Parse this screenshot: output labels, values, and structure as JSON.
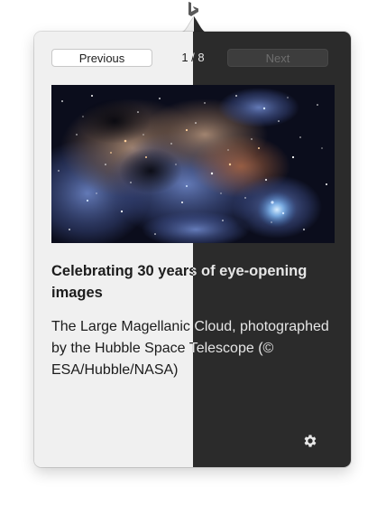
{
  "app": {
    "status_icon": "bing-logo-icon"
  },
  "navigation": {
    "previous_label": "Previous",
    "next_label": "Next",
    "counter": "1 / 8",
    "next_enabled": false
  },
  "slide": {
    "image_subject": "nebula-photo",
    "title": "Celebrating 30 years of eye-opening images",
    "description": "The Large Magellanic Cloud, photographed by the Hubble Space Telescope (© ESA/Hubble/NASA)"
  },
  "footer": {
    "settings_icon": "gear-icon"
  },
  "colors": {
    "light_panel": "#f0f0f0",
    "dark_panel": "#2b2b2b"
  }
}
